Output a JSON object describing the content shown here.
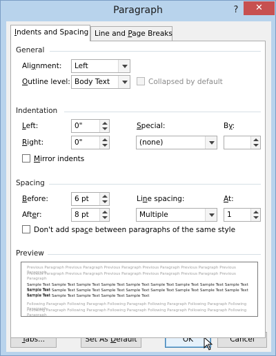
{
  "window": {
    "title": "Paragraph",
    "help_label": "?",
    "close_label": "✕"
  },
  "tabs": [
    {
      "label_pre": "",
      "label_u": "I",
      "label_post": "ndents and Spacing"
    },
    {
      "label_pre": "Line and ",
      "label_u": "P",
      "label_post": "age Breaks"
    }
  ],
  "general": {
    "heading": "General",
    "alignment_label_pre": "Ali",
    "alignment_label_u": "g",
    "alignment_label_post": "nment:",
    "alignment_value": "Left",
    "outline_label_pre": "",
    "outline_label_u": "O",
    "outline_label_post": "utline level:",
    "outline_value": "Body Text",
    "collapsed_label": "Collapsed by default"
  },
  "indentation": {
    "heading": "Indentation",
    "left_label_pre": "",
    "left_label_u": "L",
    "left_label_post": "eft:",
    "left_value": "0\"",
    "right_label_pre": "",
    "right_label_u": "R",
    "right_label_post": "ight:",
    "right_value": "0\"",
    "special_label_pre": "",
    "special_label_u": "S",
    "special_label_post": "pecial:",
    "special_value": "(none)",
    "by_label_pre": "B",
    "by_label_u": "y",
    "by_label_post": ":",
    "by_value": "",
    "mirror_label_pre": "",
    "mirror_label_u": "M",
    "mirror_label_post": "irror indents"
  },
  "spacing": {
    "heading": "Spacing",
    "before_label_pre": "",
    "before_label_u": "B",
    "before_label_post": "efore:",
    "before_value": "6 pt",
    "after_label_pre": "Aft",
    "after_label_u": "e",
    "after_label_post": "r:",
    "after_value": "8 pt",
    "line_spacing_label_pre": "Li",
    "line_spacing_label_u": "n",
    "line_spacing_label_post": "e spacing:",
    "line_spacing_value": "Multiple",
    "at_label_pre": "",
    "at_label_u": "A",
    "at_label_post": "t:",
    "at_value": "1",
    "dont_add_label_pre": "Don't add spa",
    "dont_add_label_u": "c",
    "dont_add_label_post": "e between paragraphs of the same style"
  },
  "preview": {
    "heading": "Preview",
    "previous_lines": [
      "Previous Paragraph Previous Paragraph Previous Paragraph Previous Paragraph Previous Paragraph Previous Paragraph",
      "Previous Paragraph Previous Paragraph Previous Paragraph Previous Paragraph Previous Paragraph Previous Paragraph"
    ],
    "sample_lines": [
      "Sample Text Sample Text Sample Text Sample Text Sample Text Sample Text Sample Text Sample Text Sample Text Sample Text",
      "Sample Text Sample Text Sample Text Sample Text Sample Text Sample Text Sample Text Sample Text Sample Text Sample Text",
      "Sample Text Sample Text Sample Text Sample Text Sample Text"
    ],
    "following_lines": [
      "Following Paragraph Following Paragraph Following Paragraph Following Paragraph Following Paragraph Following Paragraph",
      "Following Paragraph Following Paragraph Following Paragraph Following Paragraph Following Paragraph Following Paragraph"
    ]
  },
  "buttons": {
    "tabs_pre": "",
    "tabs_u": "T",
    "tabs_post": "abs...",
    "set_default_pre": "Set As ",
    "set_default_u": "D",
    "set_default_post": "efault",
    "ok": "OK",
    "cancel": "Cancel"
  },
  "colors": {
    "highlight": "#e08a24",
    "close_button": "#c75050",
    "frame": "#b8d3ec"
  }
}
